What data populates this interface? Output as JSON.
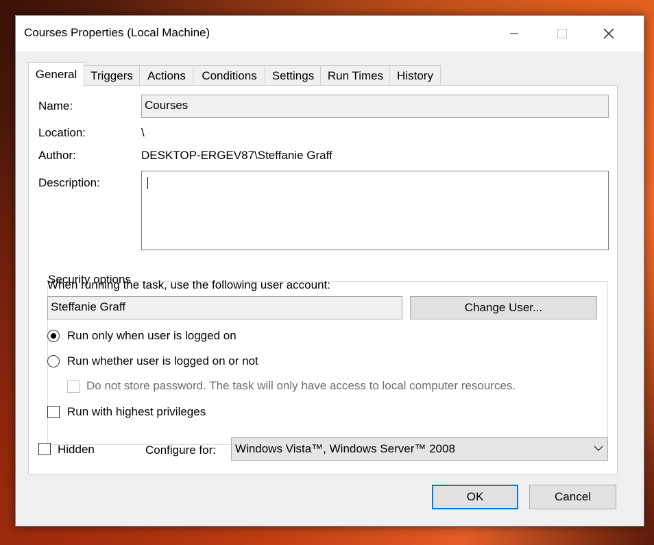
{
  "window": {
    "title": "Courses Properties (Local Machine)",
    "minimize_icon": "minimize-icon",
    "maximize_icon": "maximize-icon",
    "close_icon": "close-icon"
  },
  "tabs": [
    {
      "label": "General",
      "active": true
    },
    {
      "label": "Triggers"
    },
    {
      "label": "Actions"
    },
    {
      "label": "Conditions"
    },
    {
      "label": "Settings"
    },
    {
      "label": "Run Times"
    },
    {
      "label": "History"
    }
  ],
  "general": {
    "name_label": "Name:",
    "name_value": "Courses",
    "location_label": "Location:",
    "location_value": "\\",
    "author_label": "Author:",
    "author_value": "DESKTOP-ERGEV87\\Steffanie Graff",
    "description_label": "Description:",
    "description_value": ""
  },
  "security": {
    "title": "Security options",
    "account_prompt": "When running the task, use the following user account:",
    "user_account": "Steffanie Graff",
    "change_user_button": "Change User...",
    "radio_logged_on": "Run only when user is logged on",
    "radio_logged_on_selected": true,
    "radio_whether": "Run whether user is logged on or not",
    "radio_whether_selected": false,
    "no_store_password": "Do not store password.  The task will only have access to local computer resources.",
    "highest_privileges": "Run with highest privileges"
  },
  "bottom": {
    "hidden_label": "Hidden",
    "configure_label": "Configure for:",
    "configure_value": "Windows Vista™, Windows Server™ 2008"
  },
  "buttons": {
    "ok": "OK",
    "cancel": "Cancel"
  },
  "colors": {
    "accent": "#0078d7",
    "dialog_bg": "#f0f0f0"
  }
}
